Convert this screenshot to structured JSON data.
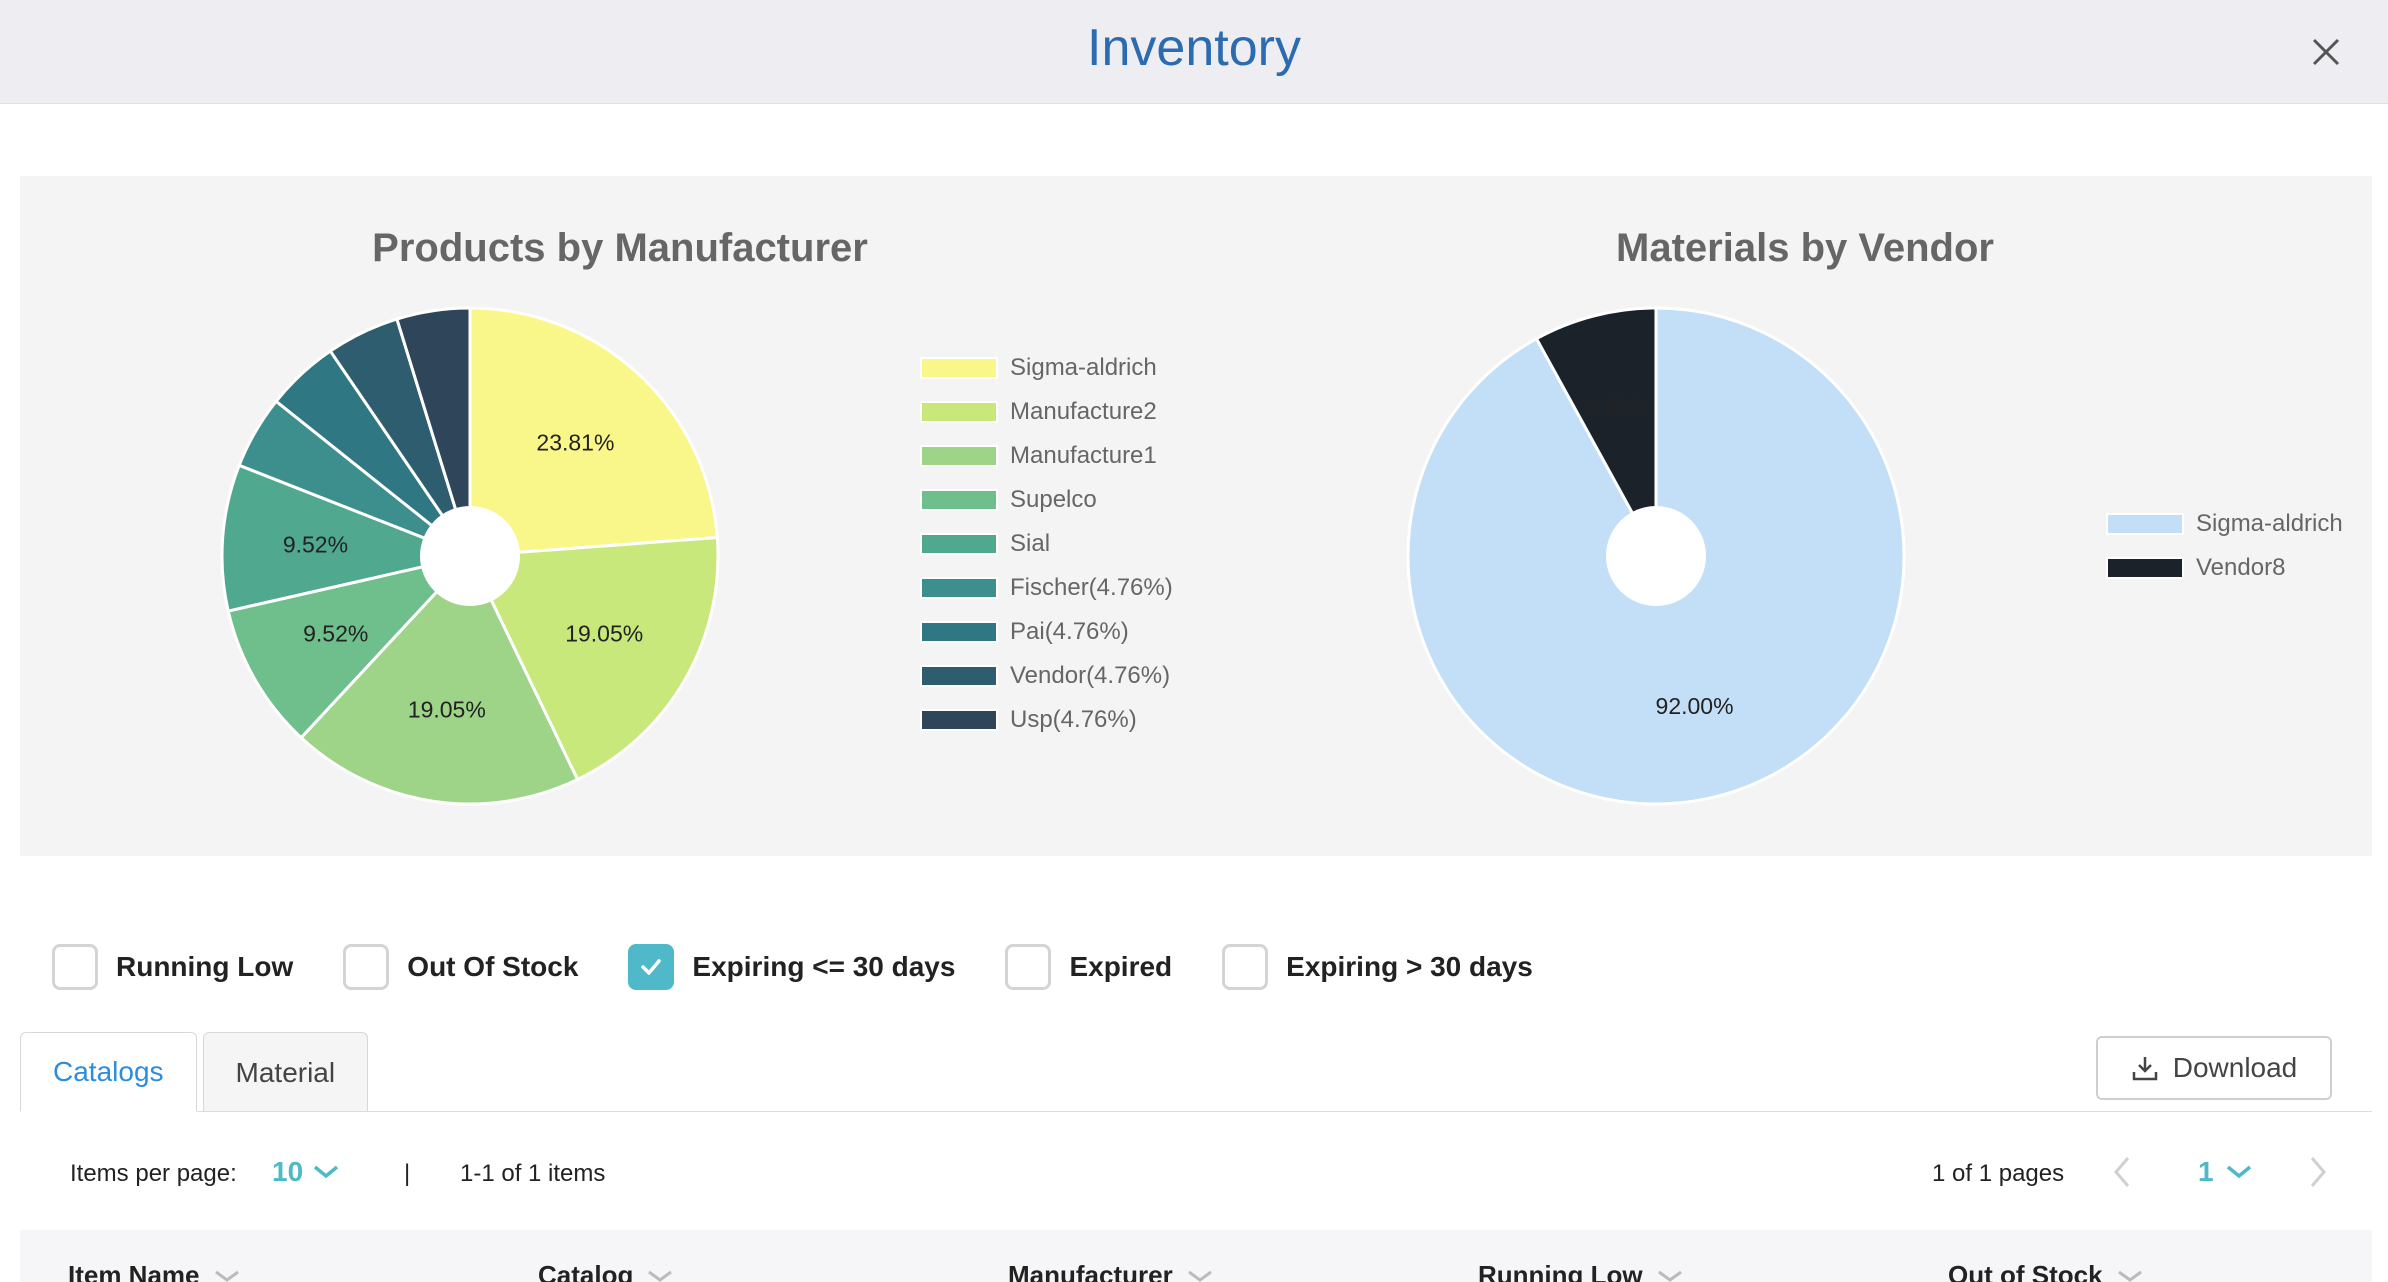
{
  "header": {
    "title": "Inventory",
    "close_icon": "close-icon"
  },
  "chart_data": [
    {
      "type": "pie",
      "title": "Products by Manufacturer",
      "donut": true,
      "labels": [
        "Sigma-aldrich",
        "Manufacture2",
        "Manufacture1",
        "Supelco",
        "Sial",
        "Fischer(4.76%)",
        "Pai(4.76%)",
        "Vendor(4.76%)",
        "Usp(4.76%)"
      ],
      "values": [
        23.81,
        19.05,
        19.05,
        9.52,
        9.52,
        4.76,
        4.76,
        4.76,
        4.76
      ],
      "data_labels": [
        "23.81%",
        "19.05%",
        "19.05%",
        "9.52%",
        "9.52%",
        "",
        "",
        "",
        ""
      ],
      "colors": [
        "#faf78a",
        "#c9e87c",
        "#9dd487",
        "#6fbf8c",
        "#50a88e",
        "#3d8f8d",
        "#2f7782",
        "#2e5d70",
        "#2f4559"
      ],
      "legend_position": "right"
    },
    {
      "type": "pie",
      "title": "Materials by Vendor",
      "donut": true,
      "labels": [
        "Sigma-aldrich",
        "Vendor8"
      ],
      "values": [
        92.0,
        8.0
      ],
      "data_labels": [
        "92.00%",
        "8.00%"
      ],
      "colors": [
        "#c2dff7",
        "#1b2229"
      ],
      "legend_position": "right"
    }
  ],
  "filters": [
    {
      "label": "Running Low",
      "checked": false
    },
    {
      "label": "Out Of Stock",
      "checked": false
    },
    {
      "label": "Expiring <= 30 days",
      "checked": true
    },
    {
      "label": "Expired",
      "checked": false
    },
    {
      "label": "Expiring > 30 days",
      "checked": false
    }
  ],
  "tabs": [
    {
      "label": "Catalogs",
      "active": true
    },
    {
      "label": "Material",
      "active": false
    }
  ],
  "download": {
    "label": "Download",
    "icon": "download-icon"
  },
  "pager": {
    "items_per_page_label": "Items per page:",
    "items_per_page_value": "10",
    "separator": "|",
    "items_range": "1-1 of 1 items",
    "pages_text": "1 of 1 pages",
    "current_page": "1",
    "accent": "#4fb8c9"
  },
  "table": {
    "columns": [
      "Item Name",
      "Catalog",
      "Manufacturer",
      "Running Low",
      "Out of Stock"
    ]
  }
}
